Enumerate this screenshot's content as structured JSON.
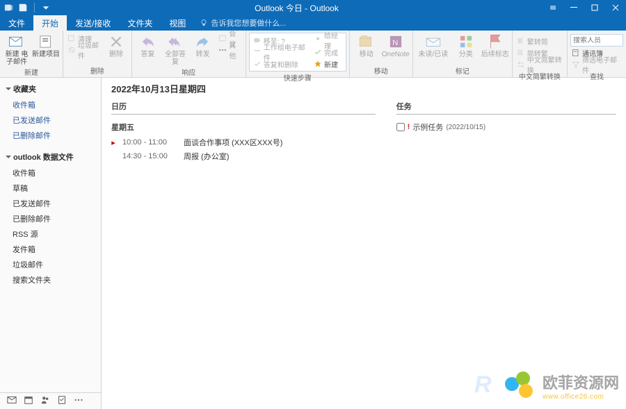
{
  "window": {
    "title": "Outlook 今日 - Outlook"
  },
  "tabs": {
    "t0": "文件",
    "t1": "开始",
    "t2": "发送/接收",
    "t3": "文件夹",
    "t4": "视图"
  },
  "tell_me": "告诉我您想要做什么...",
  "ribbon": {
    "new": {
      "label": "新建",
      "a": "新建\n电子邮件",
      "b": "新建项目"
    },
    "del": {
      "label": "删除",
      "clean": "清理",
      "junk": "垃圾邮件",
      "del": "删除"
    },
    "resp": {
      "label": "响应",
      "reply": "答复",
      "all": "全部答复",
      "fwd": "转发",
      "meet": "会议",
      "more": "其他"
    },
    "qs": {
      "label": "快速步骤",
      "a": "移至: ?",
      "b": "工作组电子邮件",
      "c": "答复和删除",
      "d": "给经理",
      "e": "完成",
      "f": "新建"
    },
    "mv": {
      "label": "移动",
      "move": "移动",
      "one": "OneNote"
    },
    "tg": {
      "label": "标记",
      "ur": "未读/已读",
      "cat": "分类",
      "flag": "后续标志"
    },
    "cn": {
      "label": "中文简繁转换",
      "a": "繁转简",
      "b": "简转繁",
      "c": "中文简繁转换"
    },
    "find": {
      "label": "查找",
      "ph": "搜索人员",
      "ab": "通讯簿",
      "fe": "筛选电子邮件"
    }
  },
  "nav": {
    "fav": "收藏夹",
    "fav_items": {
      "a": "收件箱",
      "b": "已发送邮件",
      "c": "已删除邮件"
    },
    "data": "outlook 数据文件",
    "data_items": {
      "a": "收件箱",
      "b": "草稿",
      "c": "已发送邮件",
      "d": "已删除邮件",
      "e": "RSS 源",
      "f": "发件箱",
      "g": "垃圾邮件",
      "h": "搜索文件夹"
    }
  },
  "today": {
    "date": "2022年10月13日星期四",
    "cal": "日历",
    "tasks": "任务",
    "day1": "星期五",
    "ev1": {
      "t": "10:00 - 11:00",
      "s": "面谈合作事项 (XXX区XXX号)"
    },
    "ev2": {
      "t": "14:30 - 15:00",
      "s": "周报 (办公室)"
    },
    "task1": {
      "s": "示例任务",
      "due": "(2022/10/15)"
    }
  },
  "wm": {
    "t": "欧菲资源网",
    "u": "www.office26.com"
  }
}
